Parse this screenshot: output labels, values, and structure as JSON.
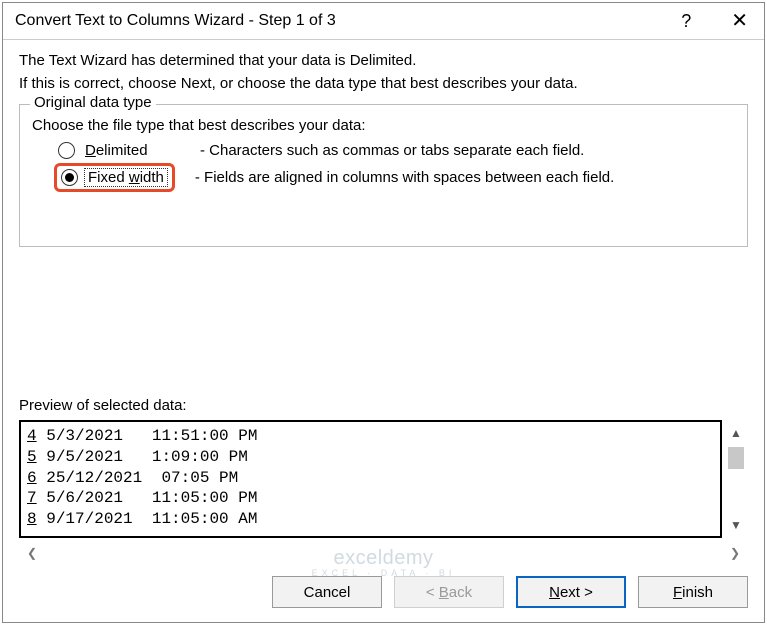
{
  "titlebar": {
    "title": "Convert Text to Columns Wizard - Step 1 of 3",
    "help": "?",
    "close": "✕"
  },
  "intro": {
    "line1": "The Text Wizard has determined that your data is Delimited.",
    "line2": "If this is correct, choose Next, or choose the data type that best describes your data."
  },
  "fieldset": {
    "legend": "Original data type",
    "choose": "Choose the file type that best describes your data:",
    "options": [
      {
        "label_pre": "",
        "label_acc": "D",
        "label_post": "elimited",
        "desc": "- Characters such as commas or tabs separate each field.",
        "selected": false
      },
      {
        "label_pre": "Fixed ",
        "label_acc": "w",
        "label_post": "idth",
        "desc": "- Fields are aligned in columns with spaces between each field.",
        "selected": true
      }
    ]
  },
  "preview": {
    "label": "Preview of selected data:",
    "rows": [
      {
        "num": "4",
        "text": "5/3/2021   11:51:00 PM"
      },
      {
        "num": "5",
        "text": "9/5/2021   1:09:00 PM"
      },
      {
        "num": "6",
        "text": "25/12/2021  07:05 PM"
      },
      {
        "num": "7",
        "text": "5/6/2021   11:05:00 PM"
      },
      {
        "num": "8",
        "text": "9/17/2021  11:05:00 AM"
      }
    ]
  },
  "buttons": {
    "cancel": "Cancel",
    "back_pre": "< ",
    "back_acc": "B",
    "back_post": "ack",
    "next_acc": "N",
    "next_post": "ext >",
    "finish_acc": "F",
    "finish_post": "inish"
  },
  "scroll": {
    "up": "▲",
    "down": "▼",
    "left": "❮",
    "right": "❯"
  },
  "watermark": {
    "main": "exceldemy",
    "sub": "EXCEL · DATA · BI"
  }
}
